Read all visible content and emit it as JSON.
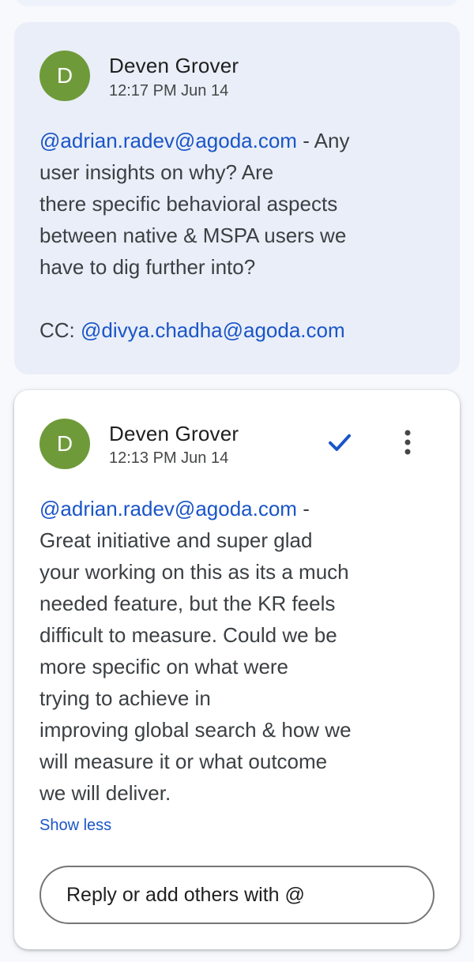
{
  "comments": [
    {
      "avatar_letter": "D",
      "author": "Deven Grover",
      "time": "12:17 PM Jun 14",
      "mention": "@adrian.radev@agoda.com",
      "text_after_mention": " - Any\nuser insights on why? Are\nthere specific behavioral aspects\nbetween native & MSPA users we\nhave to dig further into?\n\nCC: ",
      "cc_mention": "@divya.chadha@agoda.com"
    },
    {
      "avatar_letter": "D",
      "author": "Deven Grover",
      "time": "12:13 PM Jun 14",
      "mention": "@adrian.radev@agoda.com",
      "text_after_mention": "  -\nGreat initiative and super glad\nyour working on this as its a much\nneeded feature, but the KR feels\ndifficult to measure. Could we be\nmore specific on what were\ntrying to achieve in\nimproving global search & how we\nwill measure it or what outcome\nwe will deliver.",
      "show_less_label": "Show less",
      "resolve_icon": "checkmark-icon",
      "more_icon": "more-vertical-icon"
    }
  ],
  "reply": {
    "placeholder": "Reply or add others with @"
  },
  "colors": {
    "accent": "#1a55c7",
    "avatar": "#6f9a3a",
    "unfocused_card": "#e9eef8",
    "focused_card": "#ffffff"
  }
}
